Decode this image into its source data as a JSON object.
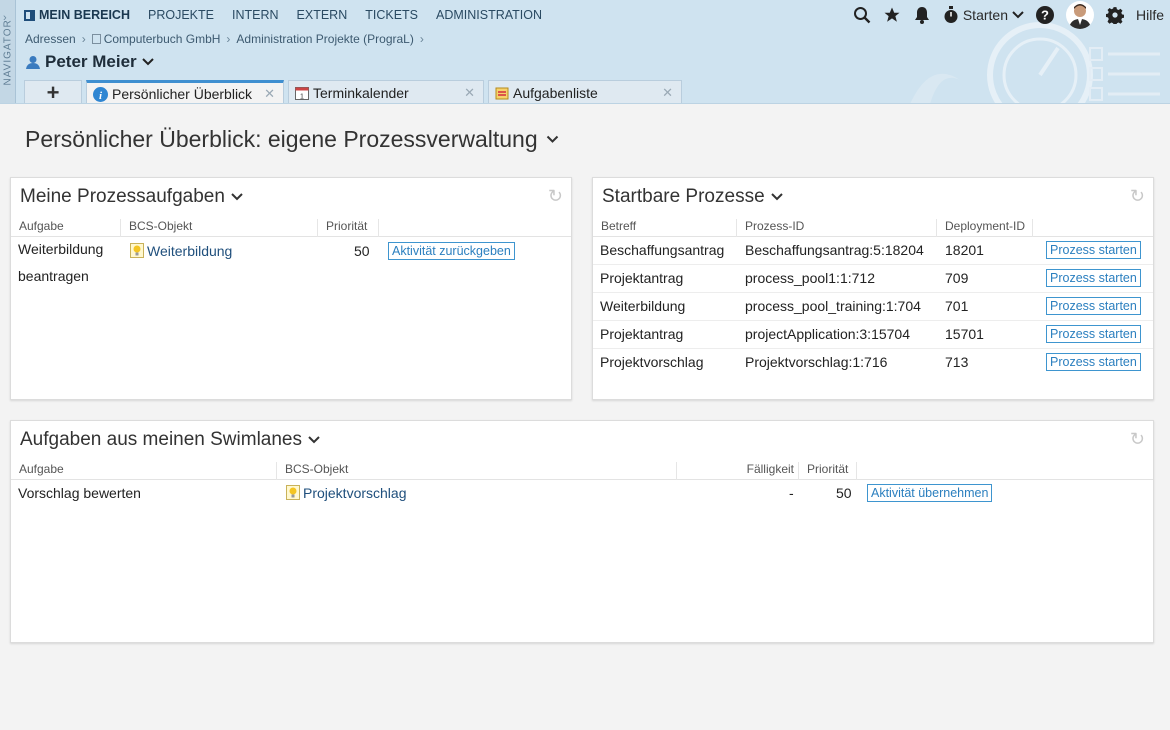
{
  "navigator": {
    "label": "NAVIGATOR"
  },
  "topnav": {
    "items": [
      {
        "label": "MEIN BEREICH"
      },
      {
        "label": "PROJEKTE"
      },
      {
        "label": "INTERN"
      },
      {
        "label": "EXTERN"
      },
      {
        "label": "TICKETS"
      },
      {
        "label": "ADMINISTRATION"
      }
    ]
  },
  "toolbar": {
    "starten_label": "Starten",
    "help_label": "Hilfe"
  },
  "breadcrumb": [
    "Adressen",
    "Computerbuch GmbH",
    "Administration Projekte (PrograL)"
  ],
  "user": {
    "name": "Peter Meier"
  },
  "tabs": [
    {
      "label": "Persönlicher Überblick"
    },
    {
      "label": "Terminkalender"
    },
    {
      "label": "Aufgabenliste"
    }
  ],
  "page": {
    "title": "Persönlicher Überblick: eigene Prozessverwaltung"
  },
  "panel_tasks": {
    "title": "Meine Prozessaufgaben",
    "headers": [
      "Aufgabe",
      "BCS-Objekt",
      "Priorität"
    ],
    "rows": [
      {
        "task_line1": "Weiterbildung",
        "task_line2": "beantragen",
        "object": "Weiterbildung",
        "priority": "50",
        "action": "Aktivität zurückgeben"
      }
    ]
  },
  "panel_startable": {
    "title": "Startbare Prozesse",
    "headers": [
      "Betreff",
      "Prozess-ID",
      "Deployment-ID"
    ],
    "rows": [
      {
        "subject": "Beschaffungsantrag",
        "process_id": "Beschaffungsantrag:5:18204",
        "deployment_id": "18201",
        "action": "Prozess starten"
      },
      {
        "subject": "Projektantrag",
        "process_id": "process_pool1:1:712",
        "deployment_id": "709",
        "action": "Prozess starten"
      },
      {
        "subject": "Weiterbildung",
        "process_id": "process_pool_training:1:704",
        "deployment_id": "701",
        "action": "Prozess starten"
      },
      {
        "subject": "Projektantrag",
        "process_id": "projectApplication:3:15704",
        "deployment_id": "15701",
        "action": "Prozess starten"
      },
      {
        "subject": "Projektvorschlag",
        "process_id": "Projektvorschlag:1:716",
        "deployment_id": "713",
        "action": "Prozess starten"
      }
    ]
  },
  "panel_swimlanes": {
    "title": "Aufgaben aus meinen Swimlanes",
    "headers": [
      "Aufgabe",
      "BCS-Objekt",
      "Fälligkeit",
      "Priorität"
    ],
    "rows": [
      {
        "task": "Vorschlag bewerten",
        "object": "Projektvorschlag",
        "due": "-",
        "priority": "50",
        "action": "Aktivität übernehmen"
      }
    ]
  },
  "colors": {
    "header_bg": "#cfe3f0",
    "accent": "#3e95cf",
    "link": "#1f4f7c"
  }
}
